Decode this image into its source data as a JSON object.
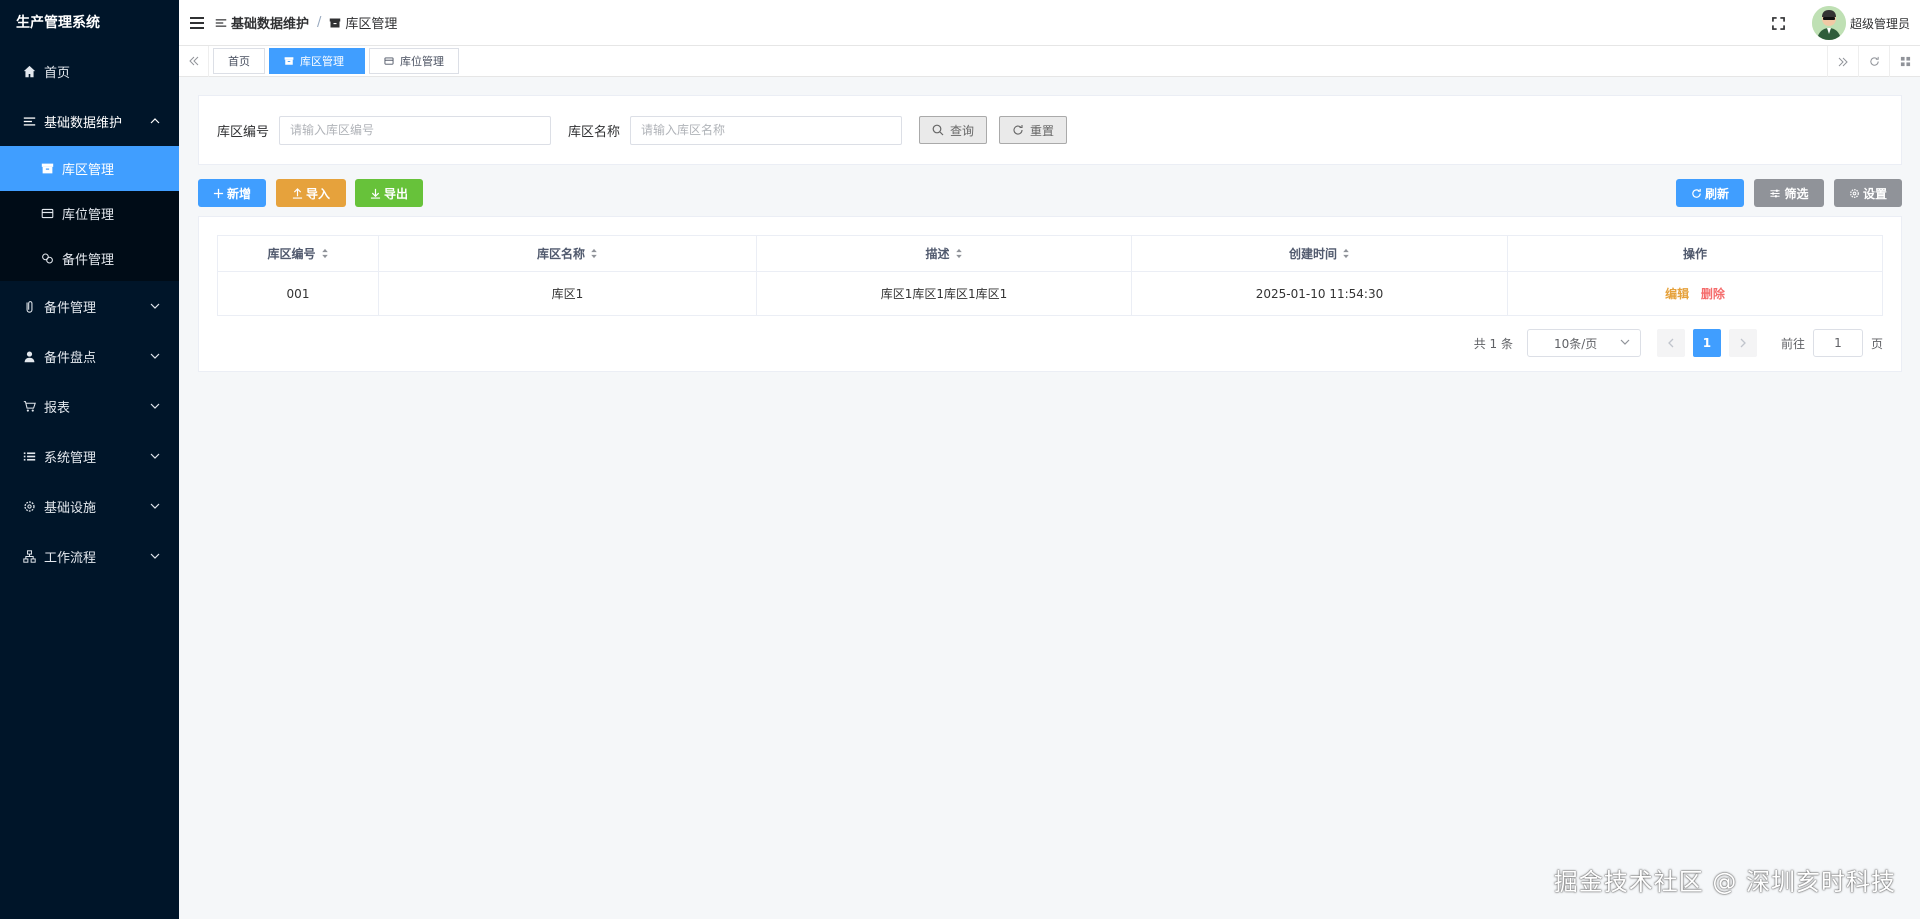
{
  "app": {
    "title": "生产管理系统"
  },
  "sidebar": {
    "items": [
      {
        "label": "首页",
        "icon": "home-icon"
      },
      {
        "label": "基础数据维护",
        "icon": "list-icon",
        "expanded": true,
        "children": [
          {
            "label": "库区管理",
            "icon": "archive-icon",
            "active": true
          },
          {
            "label": "库位管理",
            "icon": "card-icon"
          },
          {
            "label": "备件管理",
            "icon": "link-icon"
          }
        ]
      },
      {
        "label": "备件管理",
        "icon": "clip-icon"
      },
      {
        "label": "备件盘点",
        "icon": "user-icon"
      },
      {
        "label": "报表",
        "icon": "cart-icon"
      },
      {
        "label": "系统管理",
        "icon": "list-bullet-icon"
      },
      {
        "label": "基础设施",
        "icon": "gear-icon"
      },
      {
        "label": "工作流程",
        "icon": "flow-icon"
      }
    ]
  },
  "header": {
    "breadcrumb": [
      "基础数据维护",
      "库区管理"
    ],
    "separator": "/",
    "username": "超级管理员"
  },
  "tabs": [
    {
      "label": "首页"
    },
    {
      "label": "库区管理",
      "active": true
    },
    {
      "label": "库位管理"
    }
  ],
  "search": {
    "field1_label": "库区编号",
    "field1_placeholder": "请输入库区编号",
    "field1_value": "",
    "field2_label": "库区名称",
    "field2_placeholder": "请输入库区名称",
    "field2_value": "",
    "query_label": "查询",
    "reset_label": "重置"
  },
  "toolbar": {
    "add_label": "新增",
    "import_label": "导入",
    "export_label": "导出",
    "refresh_label": "刷新",
    "filter_label": "筛选",
    "settings_label": "设置"
  },
  "table": {
    "headers": [
      "库区编号",
      "库区名称",
      "描述",
      "创建时间",
      "操作"
    ],
    "rows": [
      {
        "code": "001",
        "name": "库区1",
        "desc": "库区1库区1库区1库区1",
        "created": "2025-01-10 11:54:30",
        "edit": "编辑",
        "delete": "删除"
      }
    ]
  },
  "pagination": {
    "total_text": "共 1 条",
    "page_size": "10条/页",
    "current_page": "1",
    "goto_prefix": "前往",
    "goto_value": "1",
    "goto_suffix": "页"
  },
  "watermark": "掘金技术社区 @ 深圳亥时科技",
  "colors": {
    "sidebar_bg": "#001529",
    "primary": "#409eff",
    "warning": "#e6a23c",
    "success": "#67c23a",
    "info": "#909399",
    "danger": "#f56c6c"
  }
}
